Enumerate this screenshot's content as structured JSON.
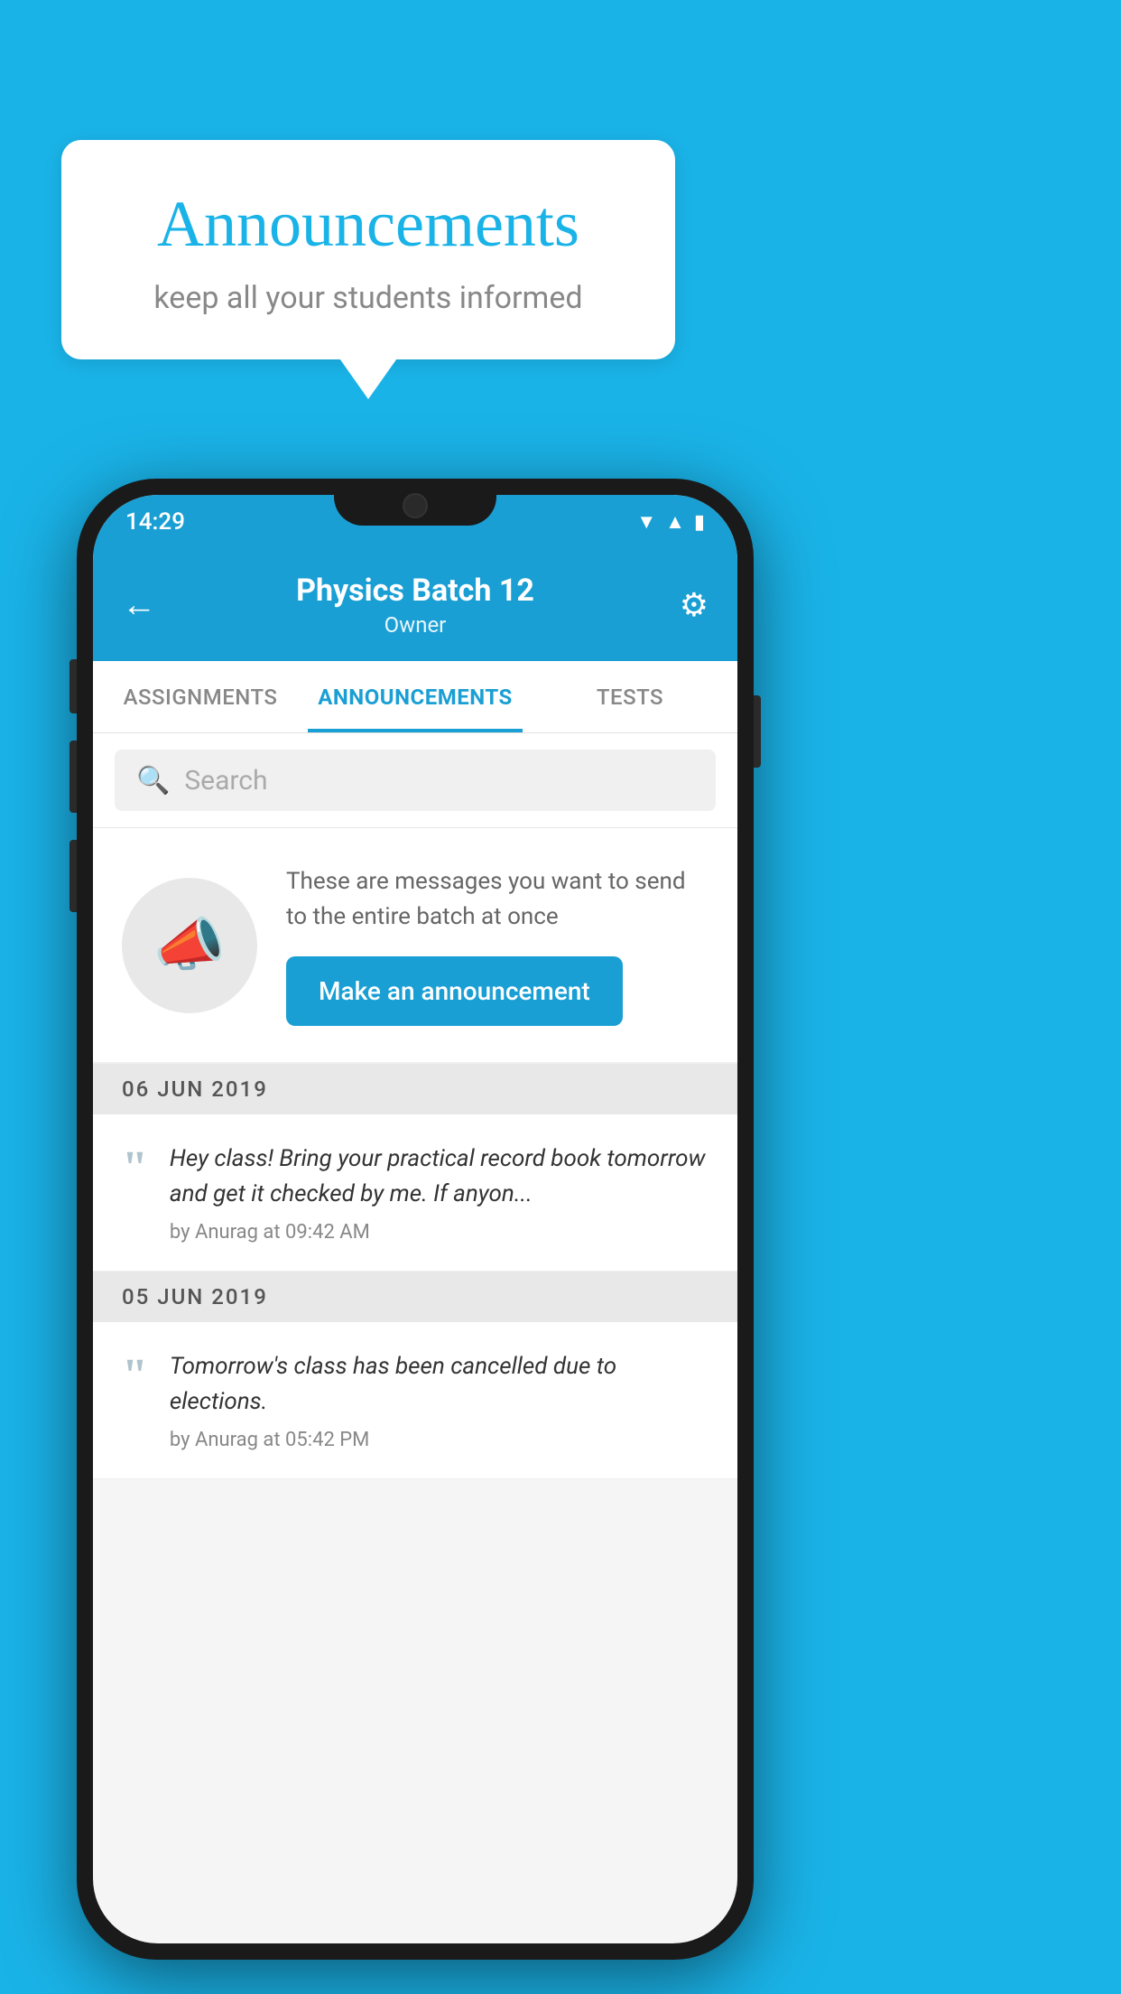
{
  "background_color": "#1ab3e8",
  "speech_bubble": {
    "title": "Announcements",
    "subtitle": "keep all your students informed"
  },
  "phone": {
    "status_bar": {
      "time": "14:29",
      "icons": [
        "wifi",
        "signal",
        "battery"
      ]
    },
    "header": {
      "back_label": "←",
      "title": "Physics Batch 12",
      "subtitle": "Owner",
      "gear_label": "⚙"
    },
    "tabs": [
      {
        "label": "ASSIGNMENTS",
        "active": false
      },
      {
        "label": "ANNOUNCEMENTS",
        "active": true
      },
      {
        "label": "TESTS",
        "active": false
      }
    ],
    "search": {
      "placeholder": "Search"
    },
    "cta_section": {
      "description": "These are messages you want to send to the entire batch at once",
      "button_label": "Make an announcement"
    },
    "announcements": [
      {
        "date": "06  JUN  2019",
        "text": "Hey class! Bring your practical record book tomorrow and get it checked by me. If anyon...",
        "author": "by Anurag at 09:42 AM"
      },
      {
        "date": "05  JUN  2019",
        "text": "Tomorrow's class has been cancelled due to elections.",
        "author": "by Anurag at 05:42 PM"
      }
    ]
  }
}
